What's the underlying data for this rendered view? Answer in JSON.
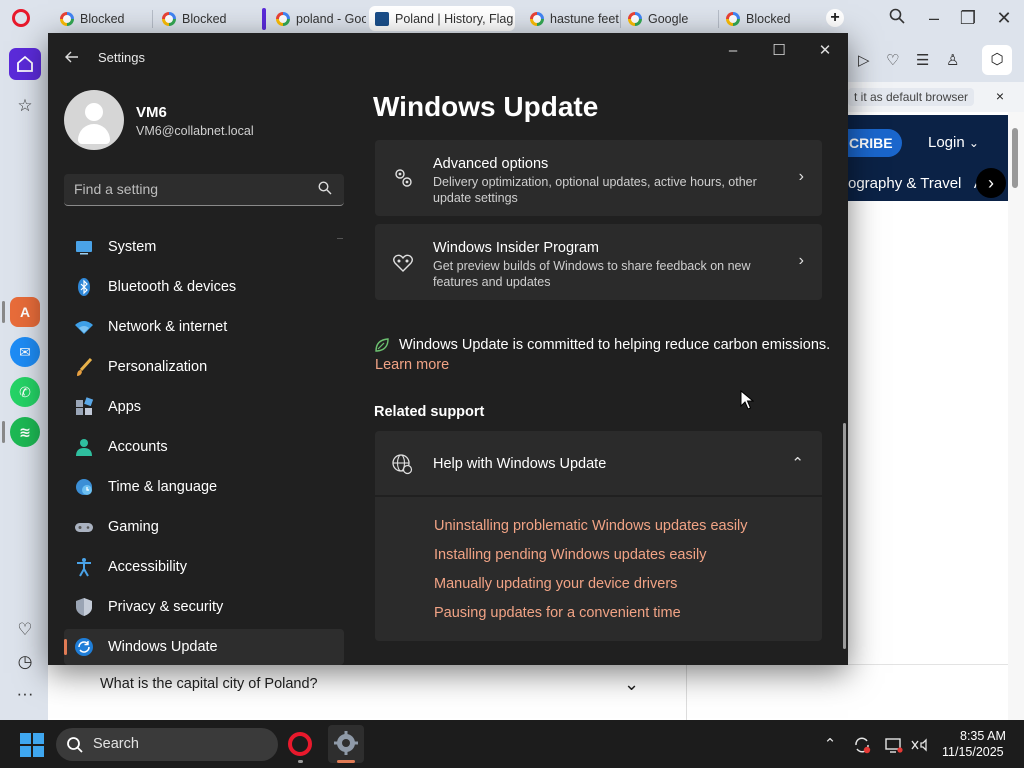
{
  "browser": {
    "tabs": [
      {
        "label": "Blocked"
      },
      {
        "label": "Blocked"
      },
      {
        "label": "poland - Goo"
      },
      {
        "label": "Poland | History, Flag"
      },
      {
        "label": "hastune feet"
      },
      {
        "label": "Google"
      },
      {
        "label": "Blocked"
      }
    ],
    "new_tab": "+",
    "notice": "t it as default browser",
    "notice_close": "×",
    "site": {
      "subscribe": "CRIBE",
      "login": "Login",
      "nav": "ography & Travel",
      "nav_more": "A"
    },
    "faq_question": "What is the capital city of Poland?"
  },
  "settings": {
    "app_title": "Settings",
    "user": {
      "name": "VM6",
      "email": "VM6@collabnet.local"
    },
    "search_placeholder": "Find a setting",
    "nav": [
      {
        "label": "System",
        "icon": "system-icon"
      },
      {
        "label": "Bluetooth & devices",
        "icon": "bluetooth-icon"
      },
      {
        "label": "Network & internet",
        "icon": "wifi-icon"
      },
      {
        "label": "Personalization",
        "icon": "brush-icon"
      },
      {
        "label": "Apps",
        "icon": "apps-icon"
      },
      {
        "label": "Accounts",
        "icon": "person-icon"
      },
      {
        "label": "Time & language",
        "icon": "globe-clock-icon"
      },
      {
        "label": "Gaming",
        "icon": "gamepad-icon"
      },
      {
        "label": "Accessibility",
        "icon": "accessibility-icon"
      },
      {
        "label": "Privacy & security",
        "icon": "shield-icon"
      },
      {
        "label": "Windows Update",
        "icon": "update-icon",
        "selected": true
      }
    ],
    "page_title": "Windows Update",
    "cards": [
      {
        "title": "Advanced options",
        "desc": "Delivery optimization, optional updates, active hours, other update settings"
      },
      {
        "title": "Windows Insider Program",
        "desc": "Get preview builds of Windows to share feedback on new features and updates"
      }
    ],
    "carbon": "Windows Update is committed to helping reduce carbon emissions.",
    "learn_more": "Learn more",
    "related_support": "Related support",
    "help": {
      "title": "Help with Windows Update",
      "links": [
        "Uninstalling problematic Windows updates easily",
        "Installing pending Windows updates easily",
        "Manually updating your device drivers",
        "Pausing updates for a convenient time"
      ]
    }
  },
  "taskbar": {
    "search_label": "Search",
    "time": "8:35 AM",
    "date": "11/15/2025"
  },
  "colors": {
    "settings_bg": "#202020",
    "card_bg": "#2b2b2b",
    "accent_link": "#f1a385",
    "opera_red": "#e8192c",
    "opera_purple": "#5b2bd9"
  }
}
